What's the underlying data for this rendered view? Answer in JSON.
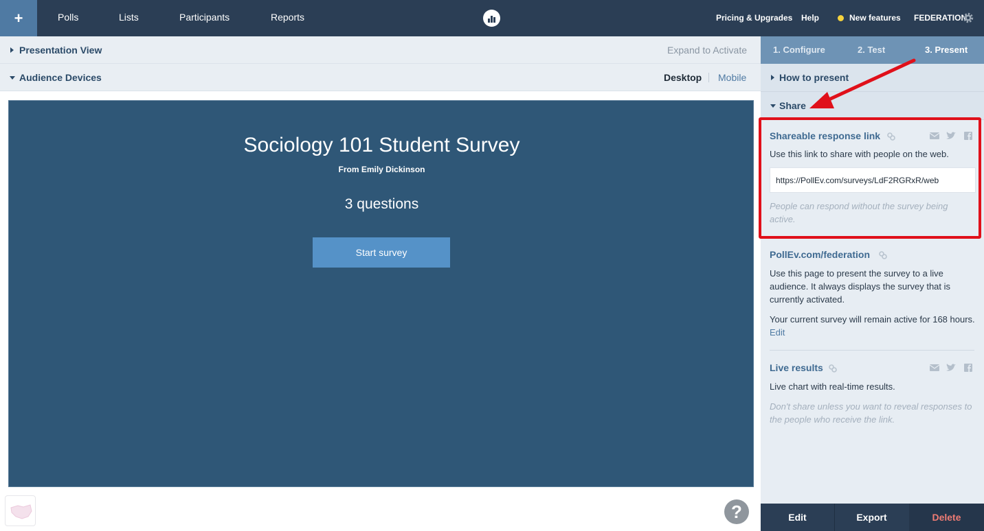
{
  "topnav": {
    "plus": "+",
    "items": [
      "Polls",
      "Lists",
      "Participants",
      "Reports"
    ],
    "pricing": "Pricing & Upgrades",
    "help": "Help",
    "new_features": "New features",
    "account": "FEDERATION"
  },
  "presentation_view": {
    "title": "Presentation View",
    "expand": "Expand to Activate"
  },
  "audience_devices": {
    "title": "Audience Devices",
    "desktop": "Desktop",
    "mobile": "Mobile"
  },
  "survey": {
    "title": "Sociology 101 Student Survey",
    "from": "From Emily Dickinson",
    "questions": "3 questions",
    "start": "Start survey"
  },
  "help_button": "?",
  "steps": [
    "1. Configure",
    "2. Test",
    "3. Present"
  ],
  "how_to_present": "How to present",
  "share": {
    "title": "Share",
    "shareable": {
      "title": "Shareable response link",
      "desc": "Use this link to share with people on the web.",
      "url": "https://PollEv.com/surveys/LdF2RGRxR/web",
      "note": "People can respond without the survey being active."
    },
    "pollev": {
      "title": "PollEv.com/federation",
      "desc": "Use this page to present the survey to a live audience. It always displays the survey that is currently activated.",
      "active_text": "Your current survey will remain active for 168 hours.",
      "edit": "Edit"
    },
    "live": {
      "title": "Live results",
      "desc": "Live chart with real-time results.",
      "note": "Don't share unless you want to reveal responses to the people who receive the link."
    }
  },
  "bottom_actions": {
    "edit": "Edit",
    "export": "Export",
    "delete": "Delete"
  },
  "colors": {
    "nav_bg": "#2b3e55",
    "stage_bg": "#2f5777",
    "accent": "#5592c8",
    "highlight": "#e0101a",
    "delete": "#f07c74"
  }
}
